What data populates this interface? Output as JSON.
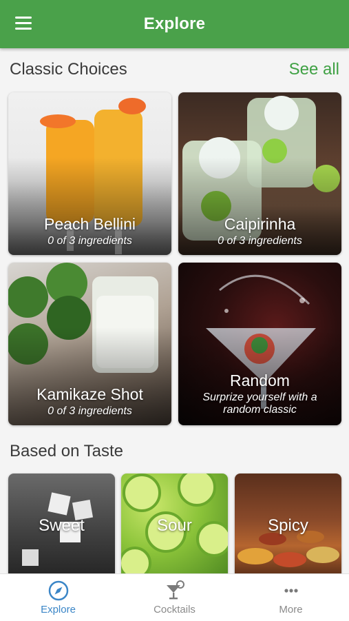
{
  "header": {
    "title": "Explore"
  },
  "classic": {
    "title": "Classic Choices",
    "see_all": "See all",
    "cards": [
      {
        "name": "Peach Bellini",
        "sub": "0 of 3 ingredients"
      },
      {
        "name": "Caipirinha",
        "sub": "0 of 3 ingredients"
      },
      {
        "name": "Kamikaze Shot",
        "sub": "0 of 3 ingredients"
      },
      {
        "name": "Random",
        "sub": "Surprize yourself with a random classic"
      }
    ]
  },
  "taste": {
    "title": "Based on Taste",
    "cards": [
      {
        "name": "Sweet"
      },
      {
        "name": "Sour"
      },
      {
        "name": "Spicy"
      }
    ]
  },
  "tabs": [
    {
      "label": "Explore",
      "icon": "compass-icon",
      "active": true
    },
    {
      "label": "Cocktails",
      "icon": "cocktail-glass-icon",
      "active": false
    },
    {
      "label": "More",
      "icon": "more-dots-icon",
      "active": false
    }
  ],
  "colors": {
    "appbar": "#4aa14a",
    "accent": "#3fa144",
    "tab_active": "#3b86c7"
  }
}
